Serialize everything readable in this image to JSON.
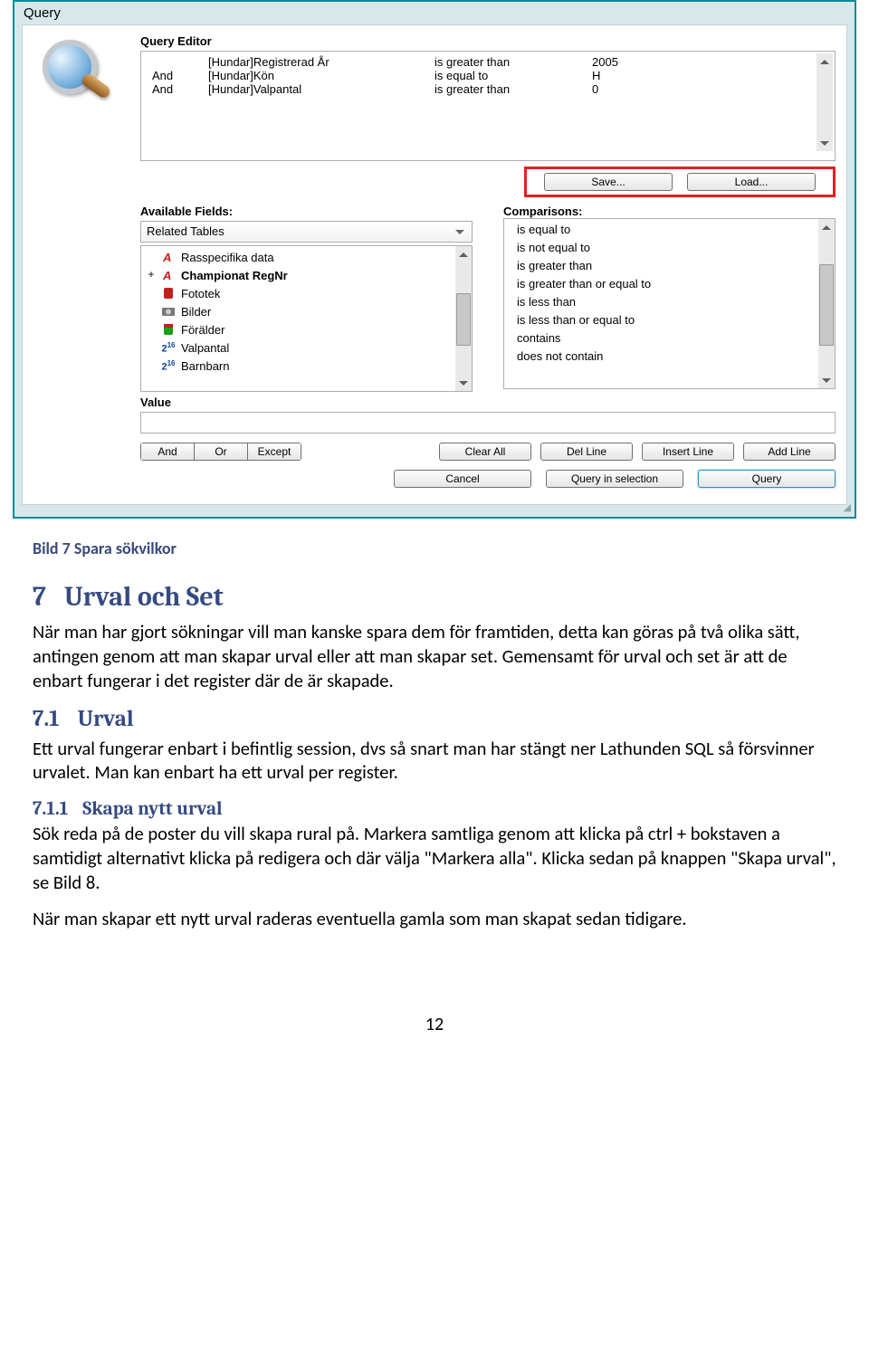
{
  "dialog": {
    "title": "Query",
    "editor_label": "Query Editor",
    "conditions": [
      {
        "op": "",
        "field": "[Hundar]Registrerad År",
        "cmp": "is greater than",
        "val": "2005"
      },
      {
        "op": "And",
        "field": "[Hundar]Kön",
        "cmp": "is equal to",
        "val": "H"
      },
      {
        "op": "And",
        "field": "[Hundar]Valpantal",
        "cmp": "is greater than",
        "val": "0"
      }
    ],
    "save_btn": "Save...",
    "load_btn": "Load...",
    "available_fields_label": "Available Fields:",
    "related_tables": "Related Tables",
    "fields": [
      {
        "label": "Rasspecifika data",
        "icon": "A",
        "bold": false,
        "plus": ""
      },
      {
        "label": "Championat RegNr",
        "icon": "A",
        "bold": true,
        "plus": "+"
      },
      {
        "label": "Fototek",
        "icon": "red",
        "bold": false,
        "plus": ""
      },
      {
        "label": "Bilder",
        "icon": "cam",
        "bold": false,
        "plus": ""
      },
      {
        "label": "Förälder",
        "icon": "green",
        "bold": false,
        "plus": ""
      },
      {
        "label": "Valpantal",
        "icon": "216",
        "bold": false,
        "plus": ""
      },
      {
        "label": "Barnbarn",
        "icon": "216",
        "bold": false,
        "plus": ""
      }
    ],
    "comparisons_label": "Comparisons:",
    "comparisons": [
      "is equal to",
      "is not equal to",
      "is greater than",
      "is greater than or equal to",
      "is less than",
      "is less than or equal to",
      "contains",
      "does not contain"
    ],
    "value_label": "Value",
    "seg": {
      "and": "And",
      "or": "Or",
      "except": "Except"
    },
    "clear_all": "Clear All",
    "del_line": "Del Line",
    "insert_line": "Insert Line",
    "add_line": "Add Line",
    "cancel": "Cancel",
    "query_in_selection": "Query in selection",
    "query": "Query"
  },
  "doc": {
    "caption": "Bild 7 Spara sökvilkor",
    "h1_num": "7",
    "h1_text": "Urval och Set",
    "p1": "När man har gjort sökningar vill man kanske spara dem för framtiden, detta kan göras på två olika sätt, antingen genom att man skapar urval eller att man skapar set. Gemensamt för urval och set är att de enbart fungerar i det register där de är skapade.",
    "h2_num": "7.1",
    "h2_text": "Urval",
    "p2": "Ett urval fungerar enbart i befintlig session, dvs så snart man har stängt ner Lathunden SQL så försvinner urvalet. Man kan enbart ha ett urval per register.",
    "h3_num": "7.1.1",
    "h3_text": "Skapa nytt urval",
    "p3": "Sök reda på de poster du vill skapa rural på. Markera samtliga genom att klicka på ctrl + bokstaven a samtidigt alternativt klicka på redigera och där välja \"Markera alla\". Klicka sedan på knappen \"Skapa urval\", se Bild 8.",
    "p4": "När man skapar ett nytt urval raderas eventuella gamla som man skapat sedan tidigare.",
    "page": "12"
  }
}
